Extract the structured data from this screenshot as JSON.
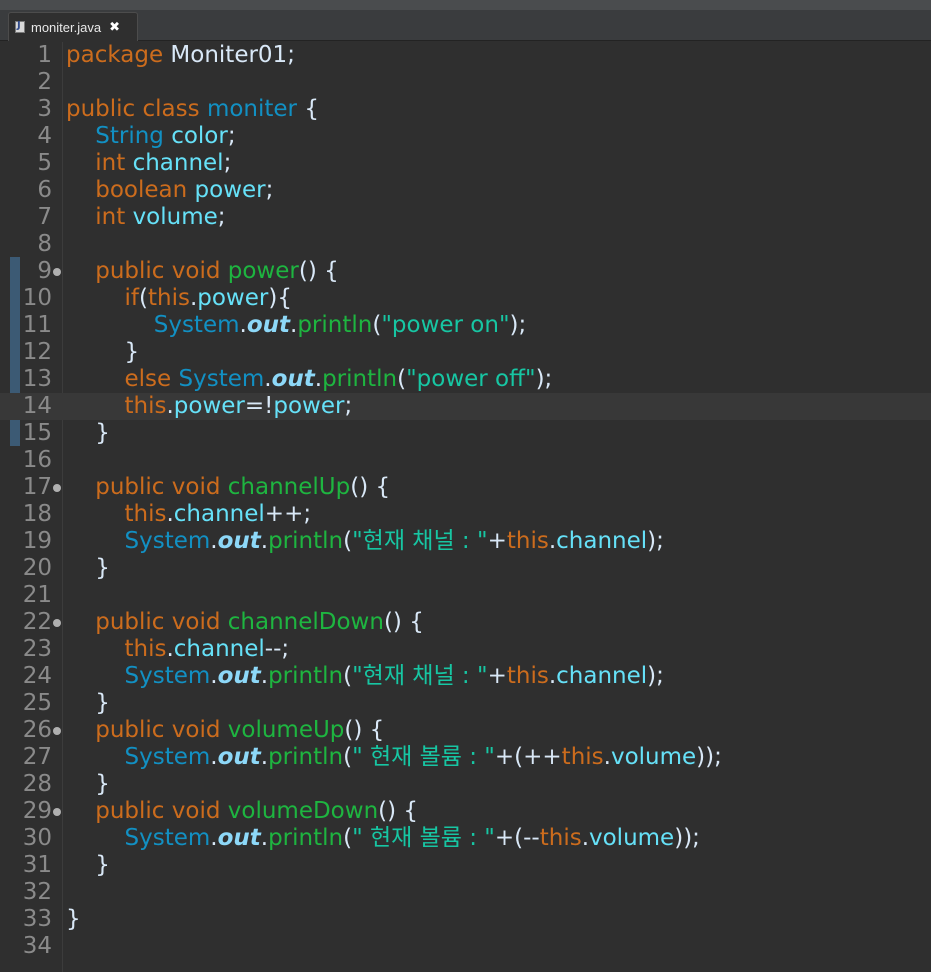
{
  "tab": {
    "title": "moniter.java",
    "close": "✖",
    "icon": "java-file-icon"
  },
  "colors": {
    "background": "#2f2f2f",
    "keyword": "#cc6c1d",
    "type": "#1290c3",
    "method_name": "#1eb540",
    "field": "#66e1f8",
    "string": "#17c6a3",
    "plain": "#d9e8f7",
    "line_number": "#8a8a8a"
  },
  "editor": {
    "current_line": 14,
    "lines": [
      {
        "n": "1",
        "fold": false,
        "tokens": [
          {
            "t": "package",
            "c": "kw"
          },
          {
            "t": " Moniter01;",
            "c": "plain"
          }
        ]
      },
      {
        "n": "2",
        "fold": false,
        "tokens": []
      },
      {
        "n": "3",
        "fold": false,
        "tokens": [
          {
            "t": "public",
            "c": "kw"
          },
          {
            "t": " ",
            "c": "plain"
          },
          {
            "t": "class",
            "c": "kw"
          },
          {
            "t": " ",
            "c": "plain"
          },
          {
            "t": "moniter",
            "c": "type"
          },
          {
            "t": " {",
            "c": "plain"
          }
        ]
      },
      {
        "n": "4",
        "fold": false,
        "tokens": [
          {
            "t": "    ",
            "c": "plain"
          },
          {
            "t": "String",
            "c": "type"
          },
          {
            "t": " ",
            "c": "plain"
          },
          {
            "t": "color",
            "c": "field"
          },
          {
            "t": ";",
            "c": "plain"
          }
        ]
      },
      {
        "n": "5",
        "fold": false,
        "tokens": [
          {
            "t": "    ",
            "c": "plain"
          },
          {
            "t": "int",
            "c": "kw"
          },
          {
            "t": " ",
            "c": "plain"
          },
          {
            "t": "channel",
            "c": "field"
          },
          {
            "t": ";",
            "c": "plain"
          }
        ]
      },
      {
        "n": "6",
        "fold": false,
        "tokens": [
          {
            "t": "    ",
            "c": "plain"
          },
          {
            "t": "boolean",
            "c": "kw"
          },
          {
            "t": " ",
            "c": "plain"
          },
          {
            "t": "power",
            "c": "field"
          },
          {
            "t": ";",
            "c": "plain"
          }
        ]
      },
      {
        "n": "7",
        "fold": false,
        "tokens": [
          {
            "t": "    ",
            "c": "plain"
          },
          {
            "t": "int",
            "c": "kw"
          },
          {
            "t": " ",
            "c": "plain"
          },
          {
            "t": "volume",
            "c": "field"
          },
          {
            "t": ";",
            "c": "plain"
          }
        ]
      },
      {
        "n": "8",
        "fold": false,
        "tokens": []
      },
      {
        "n": "9",
        "fold": true,
        "tokens": [
          {
            "t": "    ",
            "c": "plain"
          },
          {
            "t": "public",
            "c": "kw"
          },
          {
            "t": " ",
            "c": "plain"
          },
          {
            "t": "void",
            "c": "kw"
          },
          {
            "t": " ",
            "c": "plain"
          },
          {
            "t": "power",
            "c": "name"
          },
          {
            "t": "() {",
            "c": "plain"
          }
        ]
      },
      {
        "n": "10",
        "fold": false,
        "tokens": [
          {
            "t": "        ",
            "c": "plain"
          },
          {
            "t": "if",
            "c": "kw"
          },
          {
            "t": "(",
            "c": "plain"
          },
          {
            "t": "this",
            "c": "kw"
          },
          {
            "t": ".",
            "c": "plain"
          },
          {
            "t": "power",
            "c": "field"
          },
          {
            "t": "){",
            "c": "plain"
          }
        ]
      },
      {
        "n": "11",
        "fold": false,
        "tokens": [
          {
            "t": "            ",
            "c": "plain"
          },
          {
            "t": "System",
            "c": "type"
          },
          {
            "t": ".",
            "c": "plain"
          },
          {
            "t": "out",
            "c": "out"
          },
          {
            "t": ".",
            "c": "plain"
          },
          {
            "t": "println",
            "c": "name"
          },
          {
            "t": "(",
            "c": "plain"
          },
          {
            "t": "\"power on\"",
            "c": "str"
          },
          {
            "t": ");",
            "c": "plain"
          }
        ]
      },
      {
        "n": "12",
        "fold": false,
        "tokens": [
          {
            "t": "        }",
            "c": "plain"
          }
        ]
      },
      {
        "n": "13",
        "fold": false,
        "tokens": [
          {
            "t": "        ",
            "c": "plain"
          },
          {
            "t": "else",
            "c": "kw"
          },
          {
            "t": " ",
            "c": "plain"
          },
          {
            "t": "System",
            "c": "type"
          },
          {
            "t": ".",
            "c": "plain"
          },
          {
            "t": "out",
            "c": "out"
          },
          {
            "t": ".",
            "c": "plain"
          },
          {
            "t": "println",
            "c": "name"
          },
          {
            "t": "(",
            "c": "plain"
          },
          {
            "t": "\"power off\"",
            "c": "str"
          },
          {
            "t": ");",
            "c": "plain"
          }
        ]
      },
      {
        "n": "14",
        "fold": false,
        "tokens": [
          {
            "t": "        ",
            "c": "plain"
          },
          {
            "t": "this",
            "c": "kw"
          },
          {
            "t": ".",
            "c": "plain"
          },
          {
            "t": "power",
            "c": "field"
          },
          {
            "t": "=!",
            "c": "plain"
          },
          {
            "t": "power",
            "c": "field"
          },
          {
            "t": ";",
            "c": "plain"
          }
        ]
      },
      {
        "n": "15",
        "fold": false,
        "tokens": [
          {
            "t": "    }",
            "c": "plain"
          }
        ]
      },
      {
        "n": "16",
        "fold": false,
        "tokens": []
      },
      {
        "n": "17",
        "fold": true,
        "tokens": [
          {
            "t": "    ",
            "c": "plain"
          },
          {
            "t": "public",
            "c": "kw"
          },
          {
            "t": " ",
            "c": "plain"
          },
          {
            "t": "void",
            "c": "kw"
          },
          {
            "t": " ",
            "c": "plain"
          },
          {
            "t": "channelUp",
            "c": "name"
          },
          {
            "t": "() {",
            "c": "plain"
          }
        ]
      },
      {
        "n": "18",
        "fold": false,
        "tokens": [
          {
            "t": "        ",
            "c": "plain"
          },
          {
            "t": "this",
            "c": "kw"
          },
          {
            "t": ".",
            "c": "plain"
          },
          {
            "t": "channel",
            "c": "field"
          },
          {
            "t": "++;",
            "c": "plain"
          }
        ]
      },
      {
        "n": "19",
        "fold": false,
        "tokens": [
          {
            "t": "        ",
            "c": "plain"
          },
          {
            "t": "System",
            "c": "type"
          },
          {
            "t": ".",
            "c": "plain"
          },
          {
            "t": "out",
            "c": "out"
          },
          {
            "t": ".",
            "c": "plain"
          },
          {
            "t": "println",
            "c": "name"
          },
          {
            "t": "(",
            "c": "plain"
          },
          {
            "t": "\"현재 채널 : \"",
            "c": "str"
          },
          {
            "t": "+",
            "c": "plain"
          },
          {
            "t": "this",
            "c": "kw"
          },
          {
            "t": ".",
            "c": "plain"
          },
          {
            "t": "channel",
            "c": "field"
          },
          {
            "t": ");",
            "c": "plain"
          }
        ]
      },
      {
        "n": "20",
        "fold": false,
        "tokens": [
          {
            "t": "    }",
            "c": "plain"
          }
        ]
      },
      {
        "n": "21",
        "fold": false,
        "tokens": []
      },
      {
        "n": "22",
        "fold": true,
        "tokens": [
          {
            "t": "    ",
            "c": "plain"
          },
          {
            "t": "public",
            "c": "kw"
          },
          {
            "t": " ",
            "c": "plain"
          },
          {
            "t": "void",
            "c": "kw"
          },
          {
            "t": " ",
            "c": "plain"
          },
          {
            "t": "channelDown",
            "c": "name"
          },
          {
            "t": "() {",
            "c": "plain"
          }
        ]
      },
      {
        "n": "23",
        "fold": false,
        "tokens": [
          {
            "t": "        ",
            "c": "plain"
          },
          {
            "t": "this",
            "c": "kw"
          },
          {
            "t": ".",
            "c": "plain"
          },
          {
            "t": "channel",
            "c": "field"
          },
          {
            "t": "--;",
            "c": "plain"
          }
        ]
      },
      {
        "n": "24",
        "fold": false,
        "tokens": [
          {
            "t": "        ",
            "c": "plain"
          },
          {
            "t": "System",
            "c": "type"
          },
          {
            "t": ".",
            "c": "plain"
          },
          {
            "t": "out",
            "c": "out"
          },
          {
            "t": ".",
            "c": "plain"
          },
          {
            "t": "println",
            "c": "name"
          },
          {
            "t": "(",
            "c": "plain"
          },
          {
            "t": "\"현재 채널 : \"",
            "c": "str"
          },
          {
            "t": "+",
            "c": "plain"
          },
          {
            "t": "this",
            "c": "kw"
          },
          {
            "t": ".",
            "c": "plain"
          },
          {
            "t": "channel",
            "c": "field"
          },
          {
            "t": ");",
            "c": "plain"
          }
        ]
      },
      {
        "n": "25",
        "fold": false,
        "tokens": [
          {
            "t": "    }",
            "c": "plain"
          }
        ]
      },
      {
        "n": "26",
        "fold": true,
        "tokens": [
          {
            "t": "    ",
            "c": "plain"
          },
          {
            "t": "public",
            "c": "kw"
          },
          {
            "t": " ",
            "c": "plain"
          },
          {
            "t": "void",
            "c": "kw"
          },
          {
            "t": " ",
            "c": "plain"
          },
          {
            "t": "volumeUp",
            "c": "name"
          },
          {
            "t": "() {",
            "c": "plain"
          }
        ]
      },
      {
        "n": "27",
        "fold": false,
        "tokens": [
          {
            "t": "        ",
            "c": "plain"
          },
          {
            "t": "System",
            "c": "type"
          },
          {
            "t": ".",
            "c": "plain"
          },
          {
            "t": "out",
            "c": "out"
          },
          {
            "t": ".",
            "c": "plain"
          },
          {
            "t": "println",
            "c": "name"
          },
          {
            "t": "(",
            "c": "plain"
          },
          {
            "t": "\" 현재 볼륨 : \"",
            "c": "str"
          },
          {
            "t": "+(++",
            "c": "plain"
          },
          {
            "t": "this",
            "c": "kw"
          },
          {
            "t": ".",
            "c": "plain"
          },
          {
            "t": "volume",
            "c": "field"
          },
          {
            "t": "));",
            "c": "plain"
          }
        ]
      },
      {
        "n": "28",
        "fold": false,
        "tokens": [
          {
            "t": "    }",
            "c": "plain"
          }
        ]
      },
      {
        "n": "29",
        "fold": true,
        "tokens": [
          {
            "t": "    ",
            "c": "plain"
          },
          {
            "t": "public",
            "c": "kw"
          },
          {
            "t": " ",
            "c": "plain"
          },
          {
            "t": "void",
            "c": "kw"
          },
          {
            "t": " ",
            "c": "plain"
          },
          {
            "t": "volumeDown",
            "c": "name"
          },
          {
            "t": "() {",
            "c": "plain"
          }
        ]
      },
      {
        "n": "30",
        "fold": false,
        "tokens": [
          {
            "t": "        ",
            "c": "plain"
          },
          {
            "t": "System",
            "c": "type"
          },
          {
            "t": ".",
            "c": "plain"
          },
          {
            "t": "out",
            "c": "out"
          },
          {
            "t": ".",
            "c": "plain"
          },
          {
            "t": "println",
            "c": "name"
          },
          {
            "t": "(",
            "c": "plain"
          },
          {
            "t": "\" 현재 볼륨 : \"",
            "c": "str"
          },
          {
            "t": "+(--",
            "c": "plain"
          },
          {
            "t": "this",
            "c": "kw"
          },
          {
            "t": ".",
            "c": "plain"
          },
          {
            "t": "volume",
            "c": "field"
          },
          {
            "t": "));",
            "c": "plain"
          }
        ]
      },
      {
        "n": "31",
        "fold": false,
        "tokens": [
          {
            "t": "    }",
            "c": "plain"
          }
        ]
      },
      {
        "n": "32",
        "fold": false,
        "tokens": []
      },
      {
        "n": "33",
        "fold": false,
        "tokens": [
          {
            "t": "}",
            "c": "plain"
          }
        ]
      },
      {
        "n": "34",
        "fold": false,
        "tokens": []
      }
    ]
  }
}
